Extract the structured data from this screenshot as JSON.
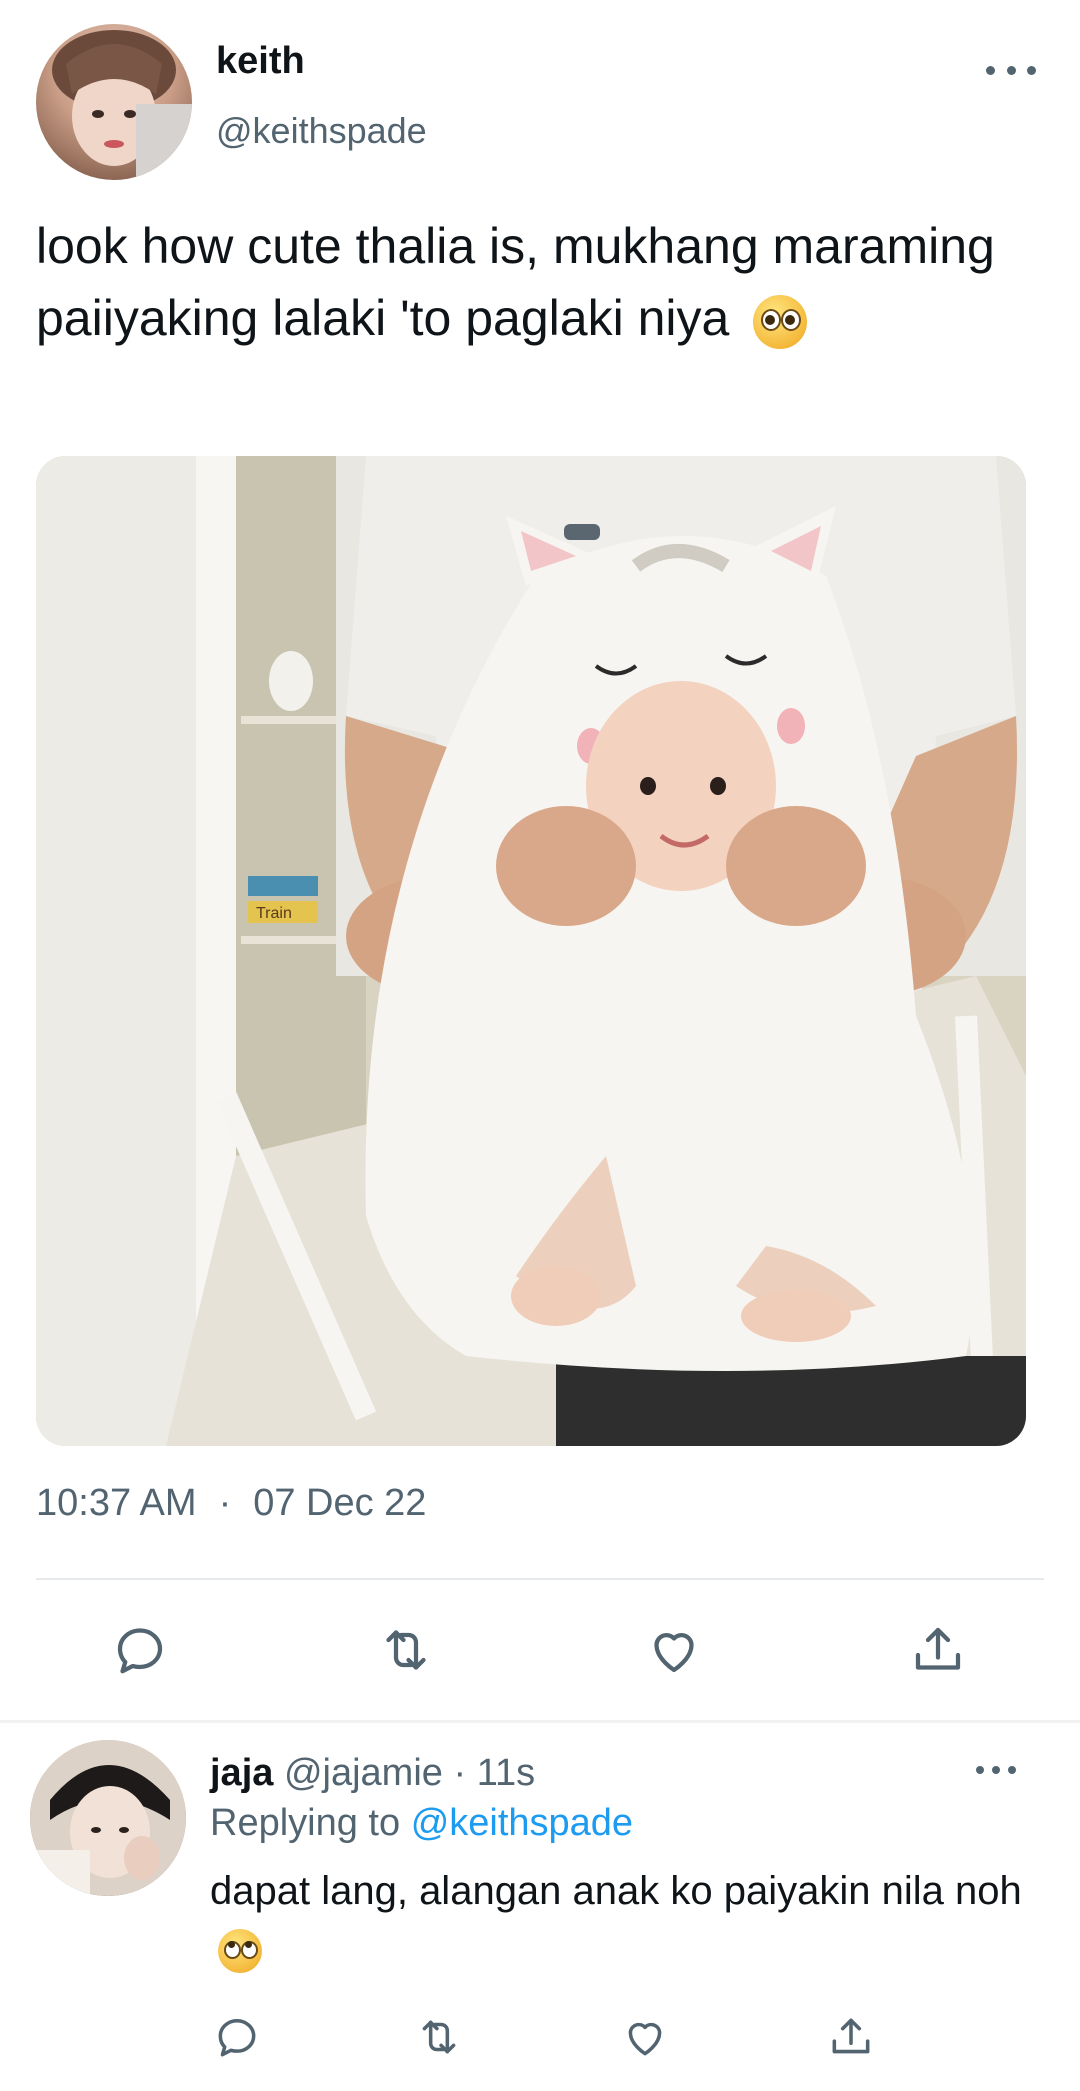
{
  "tweet": {
    "author": {
      "display_name": "keith",
      "handle": "@keithspade"
    },
    "text": "look how cute thalia is, mukhang maraming paiiyaking lalaki 'to paglaki niya",
    "emoji": "pleading-face-emoji",
    "time": "10:37 AM",
    "separator": "·",
    "date": "07 Dec 22",
    "photo_sign": "Train"
  },
  "reply": {
    "author": {
      "display_name": "jaja",
      "handle": "@jajamie"
    },
    "meta": " · 11s",
    "replying_label": "Replying to",
    "replying_to": "@keithspade",
    "text": "dapat lang, alangan anak ko paiyakin nila noh",
    "emoji": "rolling-eyes-emoji"
  },
  "icons": {
    "reply": "reply-icon",
    "retweet": "retweet-icon",
    "like": "like-icon",
    "share": "share-icon",
    "more": "more-icon"
  },
  "colors": {
    "text": "#0f1419",
    "secondary": "#536471",
    "link": "#1d9bf0",
    "divider": "#e6e9ec"
  }
}
